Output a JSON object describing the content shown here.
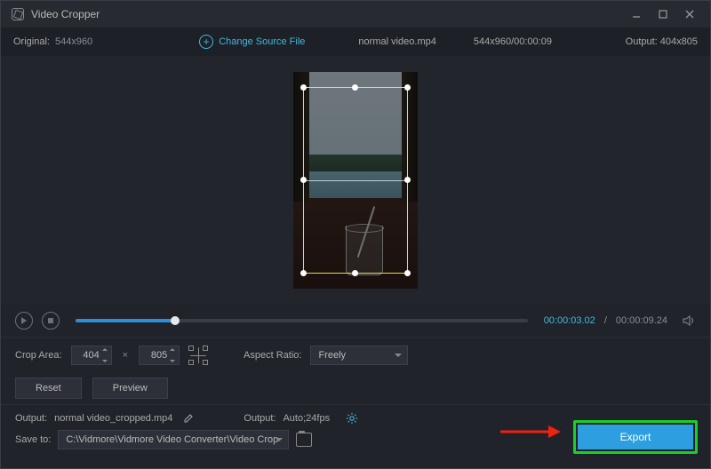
{
  "title": "Video Cropper",
  "top": {
    "original_label": "Original:",
    "original_dim": "544x960",
    "change_src": "Change Source File",
    "filename": "normal video.mp4",
    "src_info": "544x960/00:00:09",
    "output_label": "Output:",
    "output_dim": "404x805"
  },
  "player": {
    "current": "00:00:03.02",
    "sep": "/",
    "total": "00:00:09.24"
  },
  "crop": {
    "area_label": "Crop Area:",
    "w": "404",
    "h": "805",
    "ratio_label": "Aspect Ratio:",
    "ratio_val": "Freely"
  },
  "buttons": {
    "reset": "Reset",
    "preview": "Preview",
    "export": "Export"
  },
  "out": {
    "out_label": "Output:",
    "out_file": "normal video_cropped.mp4",
    "fmt_label": "Output:",
    "fmt_val": "Auto;24fps",
    "save_label": "Save to:",
    "save_path": "C:\\Vidmore\\Vidmore Video Converter\\Video Crop"
  }
}
